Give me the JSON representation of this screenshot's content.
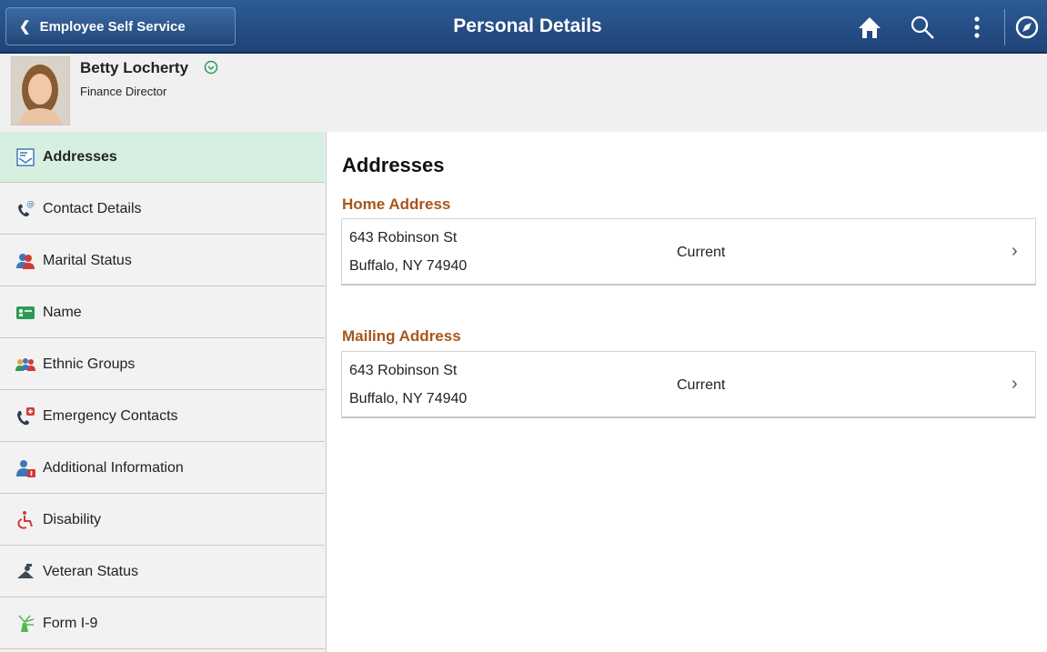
{
  "header": {
    "back_label": "Employee Self Service",
    "title": "Personal Details",
    "icons": [
      "home-icon",
      "search-icon",
      "actions-menu-icon",
      "navbar-compass-icon"
    ],
    "bar_color": "#214878"
  },
  "profile": {
    "name": "Betty Locherty",
    "job_title": "Finance Director"
  },
  "sidebar": {
    "items": [
      {
        "label": "Addresses",
        "icon": "addresses-icon",
        "active": true
      },
      {
        "label": "Contact Details",
        "icon": "contact-details-icon"
      },
      {
        "label": "Marital Status",
        "icon": "marital-status-icon"
      },
      {
        "label": "Name",
        "icon": "name-card-icon"
      },
      {
        "label": "Ethnic Groups",
        "icon": "ethnic-groups-icon"
      },
      {
        "label": "Emergency Contacts",
        "icon": "emergency-contacts-icon"
      },
      {
        "label": "Additional Information",
        "icon": "additional-info-icon"
      },
      {
        "label": "Disability",
        "icon": "disability-icon"
      },
      {
        "label": "Veteran Status",
        "icon": "veteran-status-icon"
      },
      {
        "label": "Form I-9",
        "icon": "form-i9-icon"
      }
    ],
    "active_color": "#d7efe0"
  },
  "main": {
    "heading": "Addresses",
    "sections": [
      {
        "title": "Home Address",
        "line1": "643 Robinson St",
        "line2": "Buffalo, NY 74940",
        "status": "Current"
      },
      {
        "title": "Mailing Address",
        "line1": "643 Robinson St",
        "line2": "Buffalo, NY 74940",
        "status": "Current"
      }
    ],
    "section_title_color": "#a8561b"
  }
}
